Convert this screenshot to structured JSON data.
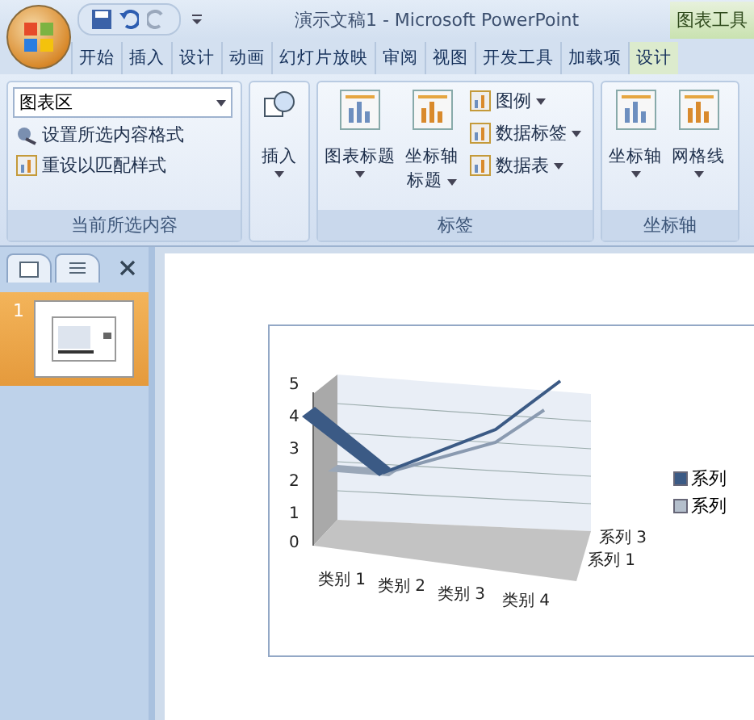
{
  "window": {
    "title": "演示文稿1 - Microsoft PowerPoint",
    "context_tab": "图表工具"
  },
  "tabs": [
    {
      "label": "开始",
      "selected": false
    },
    {
      "label": "插入",
      "selected": false
    },
    {
      "label": "设计",
      "selected": false
    },
    {
      "label": "动画",
      "selected": false
    },
    {
      "label": "幻灯片放映",
      "selected": false
    },
    {
      "label": "审阅",
      "selected": false
    },
    {
      "label": "视图",
      "selected": false
    },
    {
      "label": "开发工具",
      "selected": false
    },
    {
      "label": "加载项",
      "selected": false
    },
    {
      "label": "设计",
      "selected": false,
      "kind": "context"
    }
  ],
  "ribbon": {
    "selection": {
      "dropdown": "图表区",
      "format_button": "设置所选内容格式",
      "reset_button": "重设以匹配样式",
      "label": "当前所选内容"
    },
    "insert": {
      "button": "插入"
    },
    "labels": {
      "chart_title": "图表标题",
      "axis_title": [
        "坐标轴",
        "标题"
      ],
      "small": [
        "图例",
        "数据标签",
        "数据表"
      ],
      "label": "标签"
    },
    "axes": {
      "buttons": [
        "坐标轴",
        "网格线"
      ],
      "label": "坐标轴"
    }
  },
  "slides_pane": {
    "slides": [
      {
        "number": "1",
        "selected": true
      }
    ]
  },
  "chart": {
    "yticks": [
      "5",
      "4",
      "3",
      "2",
      "1",
      "0"
    ],
    "categories": [
      "类别 1",
      "类别 2",
      "类别 3",
      "类别 4"
    ],
    "depth": [
      "系列 3",
      "系列 1"
    ],
    "legend": [
      {
        "label": "系列",
        "color": "#3b5a85"
      },
      {
        "label": "系列",
        "color": "#b4bfcc"
      }
    ]
  }
}
